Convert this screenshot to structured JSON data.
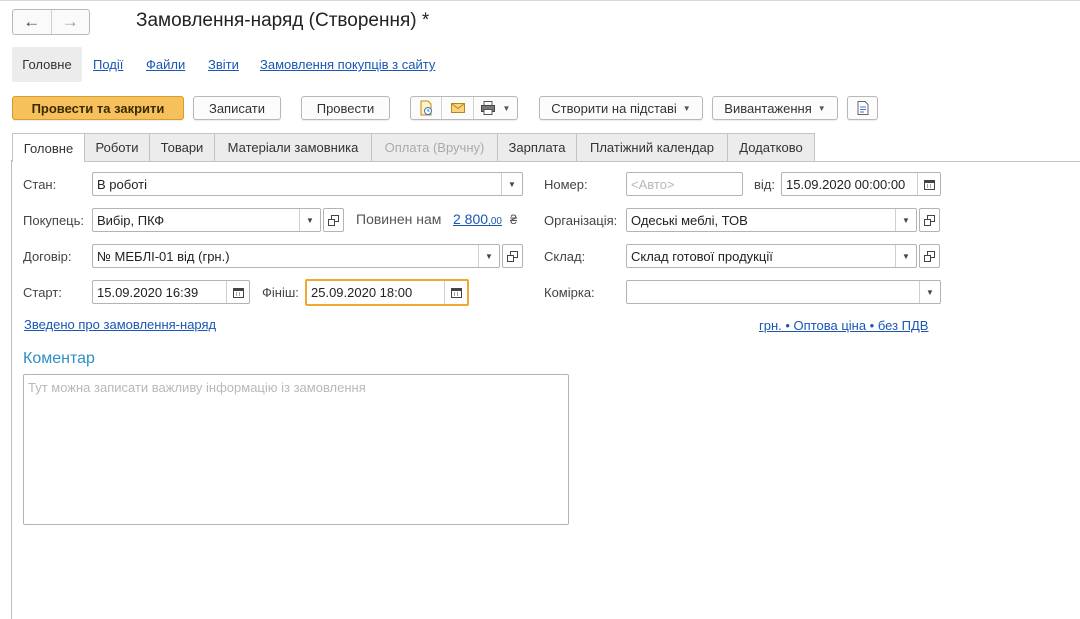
{
  "window": {
    "title": "Замовлення-наряд (Створення) *"
  },
  "nav": {
    "back_icon": "arrow-left-icon",
    "forward_icon": "arrow-right-icon",
    "back": "←",
    "forward": "→"
  },
  "top_tabs": [
    {
      "label": "Головне",
      "active": true
    },
    {
      "label": "Події"
    },
    {
      "label": "Файли"
    },
    {
      "label": "Звіти"
    },
    {
      "label": "Замовлення покупців з сайту"
    }
  ],
  "toolbar": {
    "post_close": "Провести та закрити",
    "save": "Записати",
    "post": "Провести",
    "create_based": "Створити на підставі",
    "export": "Вивантаження"
  },
  "tabs": [
    {
      "label": "Головне",
      "active": true
    },
    {
      "label": "Роботи"
    },
    {
      "label": "Товари"
    },
    {
      "label": "Матеріали замовника"
    },
    {
      "label": "Оплата (Вручну)",
      "disabled": true
    },
    {
      "label": "Зарплата"
    },
    {
      "label": "Платіжний календар"
    },
    {
      "label": "Додатково"
    }
  ],
  "form": {
    "state_label": "Стан:",
    "state_value": "В роботі",
    "number_label": "Номер:",
    "number_placeholder": "<Авто>",
    "from_label": "від:",
    "date_value": "15.09.2020 00:00:00",
    "buyer_label": "Покупець:",
    "buyer_value": "Вибір, ПКФ",
    "owes_label": "Повинен нам",
    "owes_amount": "2 800",
    "owes_cents": ",00",
    "currency_sign": "₴",
    "org_label": "Організація:",
    "org_value": "Одеські меблі, ТОВ",
    "contract_label": "Договір:",
    "contract_value": "№ МЕБЛІ-01 від  (грн.)",
    "warehouse_label": "Склад:",
    "warehouse_value": "Склад готової продукції",
    "start_label": "Старт:",
    "start_value": "15.09.2020 16:39",
    "finish_label": "Фініш:",
    "finish_value": "25.09.2020 18:00",
    "cell_label": "Комірка:",
    "cell_value": "",
    "summary_link": "Зведено про замовлення-наряд",
    "price_link": "грн. • Оптова ціна • без ПДВ",
    "comment_title": "Коментар",
    "comment_placeholder": "Тут можна записати важливу інформацію із замовлення"
  },
  "colors": {
    "primary_button": "#f6c05d",
    "link": "#1a56b4",
    "section_title": "#2d8fc7",
    "focus_border": "#f0a830"
  }
}
